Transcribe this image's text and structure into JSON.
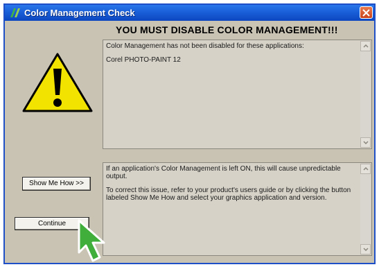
{
  "window": {
    "title": "Color Management Check",
    "heading": "YOU MUST DISABLE COLOR MANAGEMENT!!!"
  },
  "applications_panel": {
    "intro": "Color Management has not been disabled for these applications:",
    "apps": [
      "Corel PHOTO-PAINT 12"
    ]
  },
  "info_panel": {
    "paragraph1": "If an application's Color Management is left ON, this will cause unpredictable output.",
    "paragraph2": "To correct this issue, refer to your product's users guide or by clicking the button labeled Show Me How and select your graphics application and version."
  },
  "buttons": {
    "show_me_how": "Show Me How >>",
    "continue": "Continue"
  },
  "icons": {
    "app": "app-logo-icon",
    "warning": "warning-icon",
    "close": "close-icon",
    "cursor": "pointer-cursor-icon"
  },
  "colors": {
    "titlebar": "#1a5fd8",
    "dialog_bg": "#c9c3b4",
    "warning_yellow": "#f3e300",
    "cursor_green": "#3fae3a",
    "close_red": "#d5532a"
  }
}
